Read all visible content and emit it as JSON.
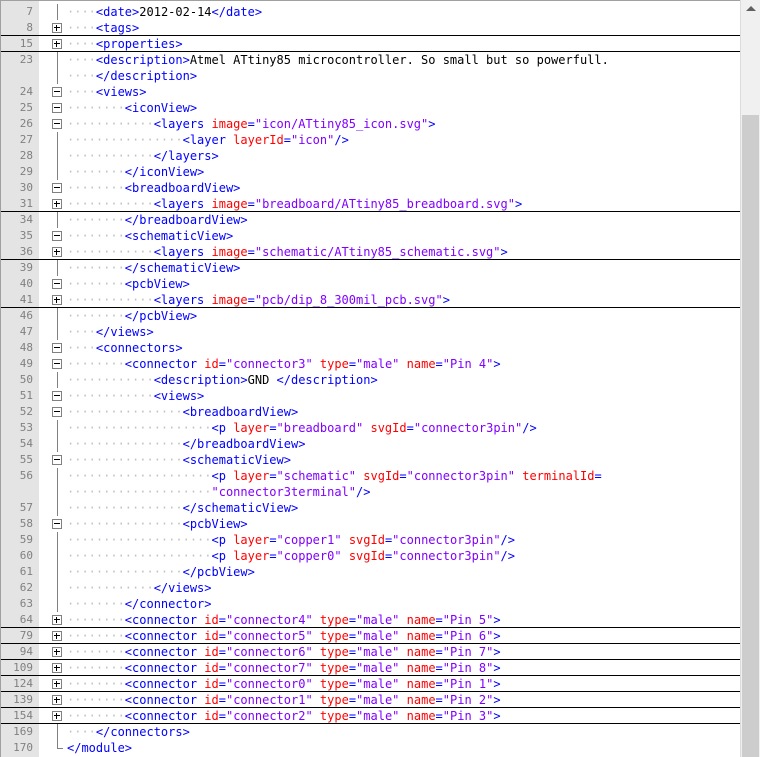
{
  "editor": {
    "lines": [
      {
        "num": "7",
        "indent": 1,
        "segs": [
          [
            "tag",
            "<date>"
          ],
          [
            "txt",
            "2012-02-14"
          ],
          [
            "tag",
            "</date>"
          ]
        ]
      },
      {
        "num": "8",
        "indent": 1,
        "fold": "plus",
        "folded": true,
        "segs": [
          [
            "tag",
            "<tags>"
          ]
        ]
      },
      {
        "num": "15",
        "indent": 1,
        "fold": "plus",
        "folded": true,
        "segs": [
          [
            "tag",
            "<properties>"
          ]
        ]
      },
      {
        "num": "23",
        "indent": 1,
        "segs": [
          [
            "tag",
            "<description>"
          ],
          [
            "txt",
            "Atmel ATtiny85 microcontroller. So small but so powerfull."
          ]
        ]
      },
      {
        "num": "",
        "indent": 1,
        "segs": [
          [
            "tag",
            "</description>"
          ]
        ]
      },
      {
        "num": "24",
        "indent": 1,
        "fold": "minus",
        "segs": [
          [
            "tag",
            "<views>"
          ]
        ]
      },
      {
        "num": "25",
        "indent": 2,
        "fold": "minus",
        "segs": [
          [
            "tag",
            "<iconView>"
          ]
        ]
      },
      {
        "num": "26",
        "indent": 3,
        "fold": "minus",
        "segs": [
          [
            "tag",
            "<layers "
          ],
          [
            "attr",
            "image"
          ],
          [
            "tag",
            "="
          ],
          [
            "val",
            "\"icon/ATtiny85_icon.svg\""
          ],
          [
            "tag",
            ">"
          ]
        ]
      },
      {
        "num": "27",
        "indent": 4,
        "segs": [
          [
            "tag",
            "<layer "
          ],
          [
            "attr",
            "layerId"
          ],
          [
            "tag",
            "="
          ],
          [
            "val",
            "\"icon\""
          ],
          [
            "tag",
            "/>"
          ]
        ]
      },
      {
        "num": "28",
        "indent": 3,
        "segs": [
          [
            "tag",
            "</layers>"
          ]
        ]
      },
      {
        "num": "29",
        "indent": 2,
        "segs": [
          [
            "tag",
            "</iconView>"
          ]
        ]
      },
      {
        "num": "30",
        "indent": 2,
        "fold": "minus",
        "segs": [
          [
            "tag",
            "<breadboardView>"
          ]
        ]
      },
      {
        "num": "31",
        "indent": 3,
        "fold": "plus",
        "folded": true,
        "segs": [
          [
            "tag",
            "<layers "
          ],
          [
            "attr",
            "image"
          ],
          [
            "tag",
            "="
          ],
          [
            "val",
            "\"breadboard/ATtiny85_breadboard.svg\""
          ],
          [
            "tag",
            ">"
          ]
        ]
      },
      {
        "num": "34",
        "indent": 2,
        "segs": [
          [
            "tag",
            "</breadboardView>"
          ]
        ]
      },
      {
        "num": "35",
        "indent": 2,
        "fold": "minus",
        "segs": [
          [
            "tag",
            "<schematicView>"
          ]
        ]
      },
      {
        "num": "36",
        "indent": 3,
        "fold": "plus",
        "folded": true,
        "segs": [
          [
            "tag",
            "<layers "
          ],
          [
            "attr",
            "image"
          ],
          [
            "tag",
            "="
          ],
          [
            "val",
            "\"schematic/ATtiny85_schematic.svg\""
          ],
          [
            "tag",
            ">"
          ]
        ]
      },
      {
        "num": "39",
        "indent": 2,
        "segs": [
          [
            "tag",
            "</schematicView>"
          ]
        ]
      },
      {
        "num": "40",
        "indent": 2,
        "fold": "minus",
        "segs": [
          [
            "tag",
            "<pcbView>"
          ]
        ]
      },
      {
        "num": "41",
        "indent": 3,
        "fold": "plus",
        "folded": true,
        "segs": [
          [
            "tag",
            "<layers "
          ],
          [
            "attr",
            "image"
          ],
          [
            "tag",
            "="
          ],
          [
            "val",
            "\"pcb/dip_8_300mil_pcb.svg\""
          ],
          [
            "tag",
            ">"
          ]
        ]
      },
      {
        "num": "46",
        "indent": 2,
        "segs": [
          [
            "tag",
            "</pcbView>"
          ]
        ]
      },
      {
        "num": "47",
        "indent": 1,
        "segs": [
          [
            "tag",
            "</views>"
          ]
        ]
      },
      {
        "num": "48",
        "indent": 1,
        "fold": "minus",
        "segs": [
          [
            "tag",
            "<connectors>"
          ]
        ]
      },
      {
        "num": "49",
        "indent": 2,
        "fold": "minus",
        "segs": [
          [
            "tag",
            "<connector "
          ],
          [
            "attr",
            "id"
          ],
          [
            "tag",
            "="
          ],
          [
            "val",
            "\"connector3\""
          ],
          [
            "tag",
            " "
          ],
          [
            "attr",
            "type"
          ],
          [
            "tag",
            "="
          ],
          [
            "val",
            "\"male\""
          ],
          [
            "tag",
            " "
          ],
          [
            "attr",
            "name"
          ],
          [
            "tag",
            "="
          ],
          [
            "val",
            "\"Pin 4\""
          ],
          [
            "tag",
            ">"
          ]
        ]
      },
      {
        "num": "50",
        "indent": 3,
        "segs": [
          [
            "tag",
            "<description>"
          ],
          [
            "txt",
            "GND "
          ],
          [
            "tag",
            "</description>"
          ]
        ]
      },
      {
        "num": "51",
        "indent": 3,
        "fold": "minus",
        "segs": [
          [
            "tag",
            "<views>"
          ]
        ]
      },
      {
        "num": "52",
        "indent": 4,
        "fold": "minus",
        "segs": [
          [
            "tag",
            "<breadboardView>"
          ]
        ]
      },
      {
        "num": "53",
        "indent": 5,
        "segs": [
          [
            "tag",
            "<p "
          ],
          [
            "attr",
            "layer"
          ],
          [
            "tag",
            "="
          ],
          [
            "val",
            "\"breadboard\""
          ],
          [
            "tag",
            " "
          ],
          [
            "attr",
            "svgId"
          ],
          [
            "tag",
            "="
          ],
          [
            "val",
            "\"connector3pin\""
          ],
          [
            "tag",
            "/>"
          ]
        ]
      },
      {
        "num": "54",
        "indent": 4,
        "segs": [
          [
            "tag",
            "</breadboardView>"
          ]
        ]
      },
      {
        "num": "55",
        "indent": 4,
        "fold": "minus",
        "segs": [
          [
            "tag",
            "<schematicView>"
          ]
        ]
      },
      {
        "num": "56",
        "indent": 5,
        "segs": [
          [
            "tag",
            "<p "
          ],
          [
            "attr",
            "layer"
          ],
          [
            "tag",
            "="
          ],
          [
            "val",
            "\"schematic\""
          ],
          [
            "tag",
            " "
          ],
          [
            "attr",
            "svgId"
          ],
          [
            "tag",
            "="
          ],
          [
            "val",
            "\"connector3pin\""
          ],
          [
            "tag",
            " "
          ],
          [
            "attr",
            "terminalId"
          ],
          [
            "tag",
            "="
          ]
        ]
      },
      {
        "num": "",
        "indent": 5,
        "segs": [
          [
            "val",
            "\"connector3terminal\""
          ],
          [
            "tag",
            "/>"
          ]
        ]
      },
      {
        "num": "57",
        "indent": 4,
        "segs": [
          [
            "tag",
            "</schematicView>"
          ]
        ]
      },
      {
        "num": "58",
        "indent": 4,
        "fold": "minus",
        "segs": [
          [
            "tag",
            "<pcbView>"
          ]
        ]
      },
      {
        "num": "59",
        "indent": 5,
        "segs": [
          [
            "tag",
            "<p "
          ],
          [
            "attr",
            "layer"
          ],
          [
            "tag",
            "="
          ],
          [
            "val",
            "\"copper1\""
          ],
          [
            "tag",
            " "
          ],
          [
            "attr",
            "svgId"
          ],
          [
            "tag",
            "="
          ],
          [
            "val",
            "\"connector3pin\""
          ],
          [
            "tag",
            "/>"
          ]
        ]
      },
      {
        "num": "60",
        "indent": 5,
        "segs": [
          [
            "tag",
            "<p "
          ],
          [
            "attr",
            "layer"
          ],
          [
            "tag",
            "="
          ],
          [
            "val",
            "\"copper0\""
          ],
          [
            "tag",
            " "
          ],
          [
            "attr",
            "svgId"
          ],
          [
            "tag",
            "="
          ],
          [
            "val",
            "\"connector3pin\""
          ],
          [
            "tag",
            "/>"
          ]
        ]
      },
      {
        "num": "61",
        "indent": 4,
        "segs": [
          [
            "tag",
            "</pcbView>"
          ]
        ]
      },
      {
        "num": "62",
        "indent": 3,
        "segs": [
          [
            "tag",
            "</views>"
          ]
        ]
      },
      {
        "num": "63",
        "indent": 2,
        "segs": [
          [
            "tag",
            "</connector>"
          ]
        ]
      },
      {
        "num": "64",
        "indent": 2,
        "fold": "plus",
        "folded": true,
        "segs": [
          [
            "tag",
            "<connector "
          ],
          [
            "attr",
            "id"
          ],
          [
            "tag",
            "="
          ],
          [
            "val",
            "\"connector4\""
          ],
          [
            "tag",
            " "
          ],
          [
            "attr",
            "type"
          ],
          [
            "tag",
            "="
          ],
          [
            "val",
            "\"male\""
          ],
          [
            "tag",
            " "
          ],
          [
            "attr",
            "name"
          ],
          [
            "tag",
            "="
          ],
          [
            "val",
            "\"Pin 5\""
          ],
          [
            "tag",
            ">"
          ]
        ]
      },
      {
        "num": "79",
        "indent": 2,
        "fold": "plus",
        "folded": true,
        "segs": [
          [
            "tag",
            "<connector "
          ],
          [
            "attr",
            "id"
          ],
          [
            "tag",
            "="
          ],
          [
            "val",
            "\"connector5\""
          ],
          [
            "tag",
            " "
          ],
          [
            "attr",
            "type"
          ],
          [
            "tag",
            "="
          ],
          [
            "val",
            "\"male\""
          ],
          [
            "tag",
            " "
          ],
          [
            "attr",
            "name"
          ],
          [
            "tag",
            "="
          ],
          [
            "val",
            "\"Pin 6\""
          ],
          [
            "tag",
            ">"
          ]
        ]
      },
      {
        "num": "94",
        "indent": 2,
        "fold": "plus",
        "folded": true,
        "segs": [
          [
            "tag",
            "<connector "
          ],
          [
            "attr",
            "id"
          ],
          [
            "tag",
            "="
          ],
          [
            "val",
            "\"connector6\""
          ],
          [
            "tag",
            " "
          ],
          [
            "attr",
            "type"
          ],
          [
            "tag",
            "="
          ],
          [
            "val",
            "\"male\""
          ],
          [
            "tag",
            " "
          ],
          [
            "attr",
            "name"
          ],
          [
            "tag",
            "="
          ],
          [
            "val",
            "\"Pin 7\""
          ],
          [
            "tag",
            ">"
          ]
        ]
      },
      {
        "num": "109",
        "indent": 2,
        "fold": "plus",
        "folded": true,
        "segs": [
          [
            "tag",
            "<connector "
          ],
          [
            "attr",
            "id"
          ],
          [
            "tag",
            "="
          ],
          [
            "val",
            "\"connector7\""
          ],
          [
            "tag",
            " "
          ],
          [
            "attr",
            "type"
          ],
          [
            "tag",
            "="
          ],
          [
            "val",
            "\"male\""
          ],
          [
            "tag",
            " "
          ],
          [
            "attr",
            "name"
          ],
          [
            "tag",
            "="
          ],
          [
            "val",
            "\"Pin 8\""
          ],
          [
            "tag",
            ">"
          ]
        ]
      },
      {
        "num": "124",
        "indent": 2,
        "fold": "plus",
        "folded": true,
        "segs": [
          [
            "tag",
            "<connector "
          ],
          [
            "attr",
            "id"
          ],
          [
            "tag",
            "="
          ],
          [
            "val",
            "\"connector0\""
          ],
          [
            "tag",
            " "
          ],
          [
            "attr",
            "type"
          ],
          [
            "tag",
            "="
          ],
          [
            "val",
            "\"male\""
          ],
          [
            "tag",
            " "
          ],
          [
            "attr",
            "name"
          ],
          [
            "tag",
            "="
          ],
          [
            "val",
            "\"Pin 1\""
          ],
          [
            "tag",
            ">"
          ]
        ]
      },
      {
        "num": "139",
        "indent": 2,
        "fold": "plus",
        "folded": true,
        "segs": [
          [
            "tag",
            "<connector "
          ],
          [
            "attr",
            "id"
          ],
          [
            "tag",
            "="
          ],
          [
            "val",
            "\"connector1\""
          ],
          [
            "tag",
            " "
          ],
          [
            "attr",
            "type"
          ],
          [
            "tag",
            "="
          ],
          [
            "val",
            "\"male\""
          ],
          [
            "tag",
            " "
          ],
          [
            "attr",
            "name"
          ],
          [
            "tag",
            "="
          ],
          [
            "val",
            "\"Pin 2\""
          ],
          [
            "tag",
            ">"
          ]
        ]
      },
      {
        "num": "154",
        "indent": 2,
        "fold": "plus",
        "folded": true,
        "segs": [
          [
            "tag",
            "<connector "
          ],
          [
            "attr",
            "id"
          ],
          [
            "tag",
            "="
          ],
          [
            "val",
            "\"connector2\""
          ],
          [
            "tag",
            " "
          ],
          [
            "attr",
            "type"
          ],
          [
            "tag",
            "="
          ],
          [
            "val",
            "\"male\""
          ],
          [
            "tag",
            " "
          ],
          [
            "attr",
            "name"
          ],
          [
            "tag",
            "="
          ],
          [
            "val",
            "\"Pin 3\""
          ],
          [
            "tag",
            ">"
          ]
        ]
      },
      {
        "num": "169",
        "indent": 1,
        "segs": [
          [
            "tag",
            "</connectors>"
          ]
        ]
      },
      {
        "num": "170",
        "indent": 0,
        "end": true,
        "segs": [
          [
            "tag",
            "</module>"
          ]
        ]
      }
    ]
  },
  "colors": {
    "tag": "#0000ff",
    "attr": "#ff0000",
    "val": "#8000ff",
    "text": "#000000",
    "line_number": "#808080",
    "gutter": "#e4e4e4"
  },
  "scrollbar": {
    "icon": "scroll-up-arrow-icon"
  }
}
